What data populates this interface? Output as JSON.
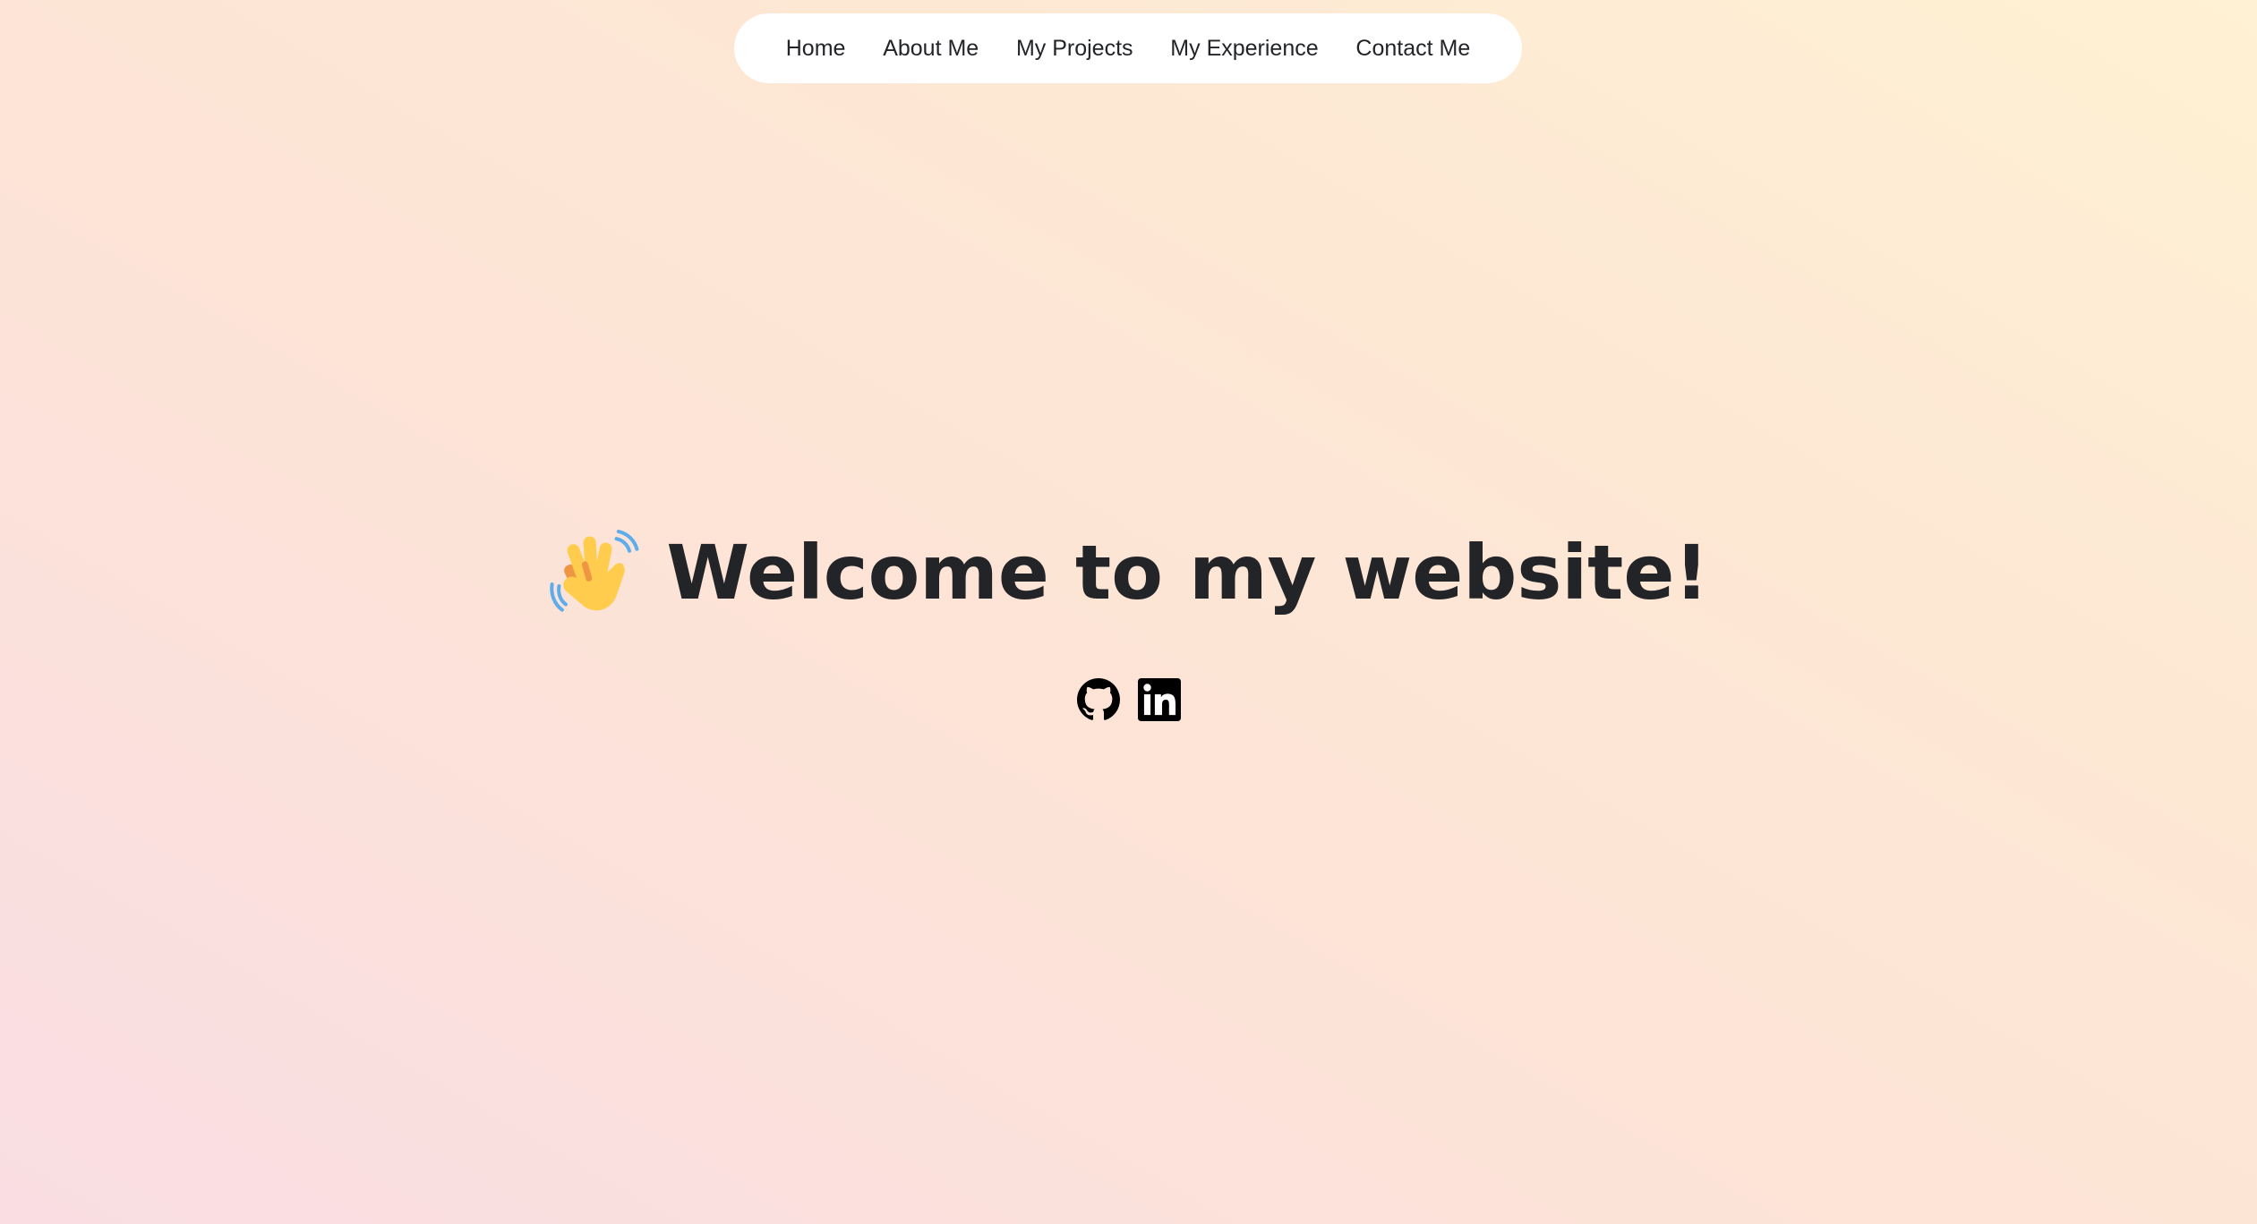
{
  "nav": {
    "items": [
      {
        "label": "Home"
      },
      {
        "label": "About Me"
      },
      {
        "label": "My Projects"
      },
      {
        "label": "My Experience"
      },
      {
        "label": "Contact Me"
      }
    ]
  },
  "hero": {
    "emoji_icon": "waving-hand-icon",
    "heading": "Welcome to my website!"
  },
  "socials": [
    {
      "icon": "github-icon"
    },
    {
      "icon": "linkedin-icon"
    }
  ],
  "colors": {
    "text": "#222428",
    "nav_bg": "#ffffff",
    "wave_hand": "#FFCC4D",
    "wave_motion": "#5DADEC"
  }
}
